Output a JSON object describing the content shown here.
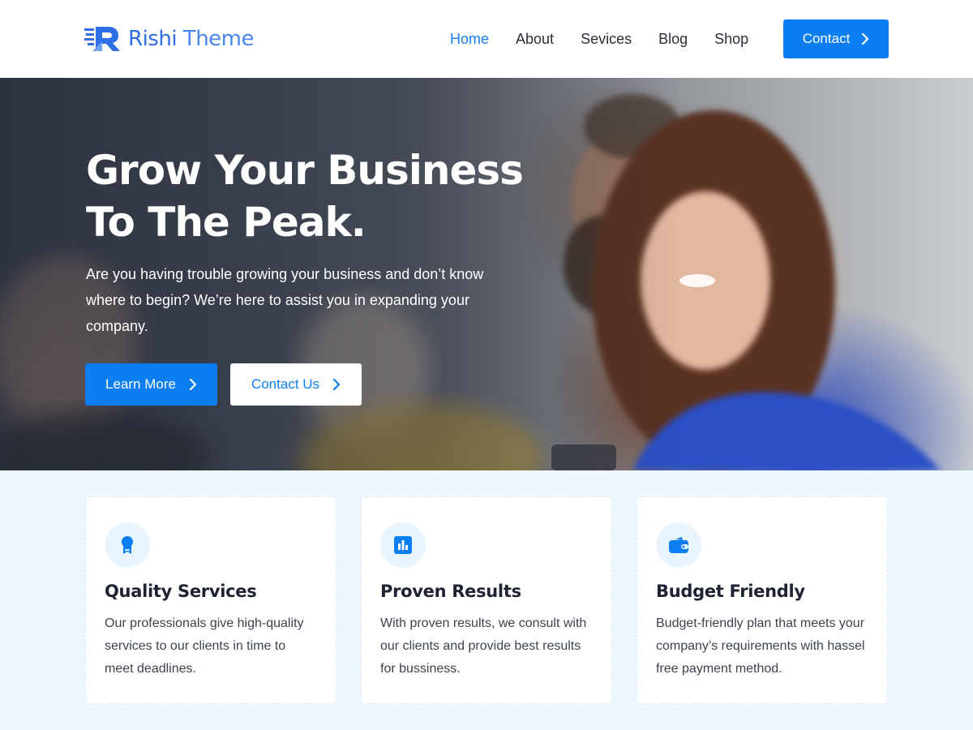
{
  "header": {
    "logo_main": "Rishi",
    "logo_light": " Theme",
    "nav": [
      "Home",
      "About",
      "Sevices",
      "Blog",
      "Shop"
    ],
    "active_nav": "Home",
    "contact_label": "Contact"
  },
  "hero": {
    "title_line1": "Grow Your Business",
    "title_line2": "To The Peak.",
    "subtitle": "Are you having trouble growing your business and don’t know where to begin? We’re here to assist you in expanding your company.",
    "learn_more_label": "Learn More",
    "contact_us_label": "Contact Us"
  },
  "features": [
    {
      "icon": "award-ribbon-icon",
      "title": "Quality Services",
      "text": "Our professionals give high-quality services to our clients in time to meet deadlines."
    },
    {
      "icon": "bar-chart-icon",
      "title": "Proven Results",
      "text": "With proven results, we consult with our clients and provide best results for bussiness."
    },
    {
      "icon": "wallet-icon",
      "title": "Budget Friendly",
      "text": "Budget-friendly plan that meets your company’s requirements with hassel free payment method."
    }
  ],
  "colors": {
    "accent": "#0b7ef3",
    "feature_bg": "#eef7fe",
    "icon_bg": "#e8f4fe"
  }
}
